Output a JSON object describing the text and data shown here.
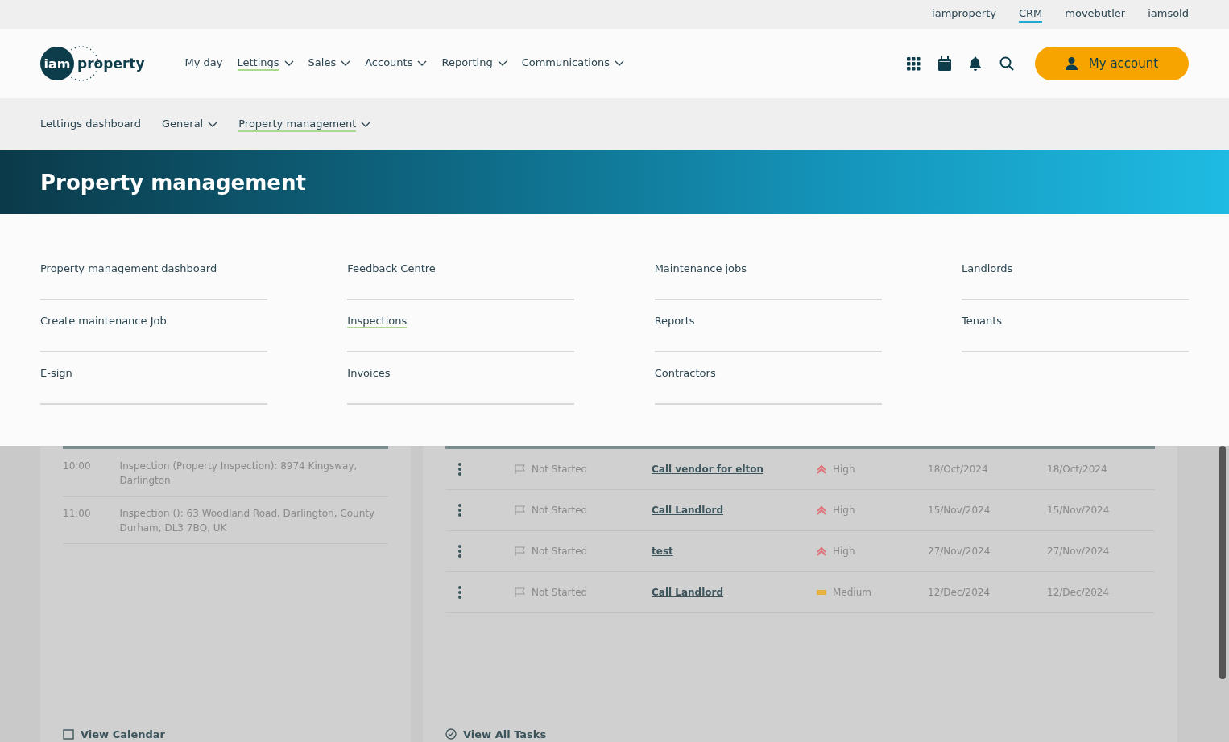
{
  "brand_links": [
    {
      "label": "iamproperty",
      "selected": false
    },
    {
      "label": "CRM",
      "selected": true
    },
    {
      "label": "movebutler",
      "selected": false
    },
    {
      "label": "iamsold",
      "selected": false
    }
  ],
  "logo": {
    "mark": "iam",
    "word": "property"
  },
  "main_nav": [
    {
      "label": "My day",
      "dropdown": false,
      "selected": false
    },
    {
      "label": "Lettings",
      "dropdown": true,
      "selected": true
    },
    {
      "label": "Sales",
      "dropdown": true,
      "selected": false
    },
    {
      "label": "Accounts",
      "dropdown": true,
      "selected": false
    },
    {
      "label": "Reporting",
      "dropdown": true,
      "selected": false
    },
    {
      "label": "Communications",
      "dropdown": true,
      "selected": false
    }
  ],
  "account_button": "My account",
  "sub_nav": [
    {
      "label": "Lettings dashboard",
      "dropdown": false,
      "selected": false
    },
    {
      "label": "General",
      "dropdown": true,
      "selected": false
    },
    {
      "label": "Property management",
      "dropdown": true,
      "selected": true
    }
  ],
  "banner_title": "Property management",
  "menu_columns": [
    [
      {
        "label": "Property management dashboard",
        "selected": false
      },
      {
        "label": "Create maintenance Job",
        "selected": false
      },
      {
        "label": "E-sign",
        "selected": false
      }
    ],
    [
      {
        "label": "Feedback Centre",
        "selected": false
      },
      {
        "label": "Inspections",
        "selected": true
      },
      {
        "label": "Invoices",
        "selected": false
      }
    ],
    [
      {
        "label": "Maintenance jobs",
        "selected": false
      },
      {
        "label": "Reports",
        "selected": false
      },
      {
        "label": "Contractors",
        "selected": false
      }
    ],
    [
      {
        "label": "Landlords",
        "selected": false
      },
      {
        "label": "Tenants",
        "selected": false
      }
    ]
  ],
  "calendar": {
    "events": [
      {
        "time": "10:00",
        "text": "Inspection (Property Inspection): 8974 Kingsway, Darlington"
      },
      {
        "time": "11:00",
        "text": "Inspection (): 63 Woodland Road, Darlington, County Durham, DL3 7BQ, UK"
      }
    ],
    "footer_link": "View Calendar"
  },
  "tasks": {
    "rows": [
      {
        "status": "Not Started",
        "task": "Call vendor for elton",
        "priority": "High",
        "color": "#e0707a",
        "kind": "high",
        "date_1": "18/Oct/2024",
        "date_2": "18/Oct/2024"
      },
      {
        "status": "Not Started",
        "task": "Call Landlord",
        "priority": "High",
        "color": "#e0707a",
        "kind": "high",
        "date_1": "15/Nov/2024",
        "date_2": "15/Nov/2024"
      },
      {
        "status": "Not Started",
        "task": "test",
        "priority": "High",
        "color": "#e0707a",
        "kind": "high",
        "date_1": "27/Nov/2024",
        "date_2": "27/Nov/2024"
      },
      {
        "status": "Not Started",
        "task": "Call Landlord",
        "priority": "Medium",
        "color": "#e6b43c",
        "kind": "medium",
        "date_1": "12/Dec/2024",
        "date_2": "12/Dec/2024"
      }
    ],
    "footer_link": "View All Tasks"
  }
}
